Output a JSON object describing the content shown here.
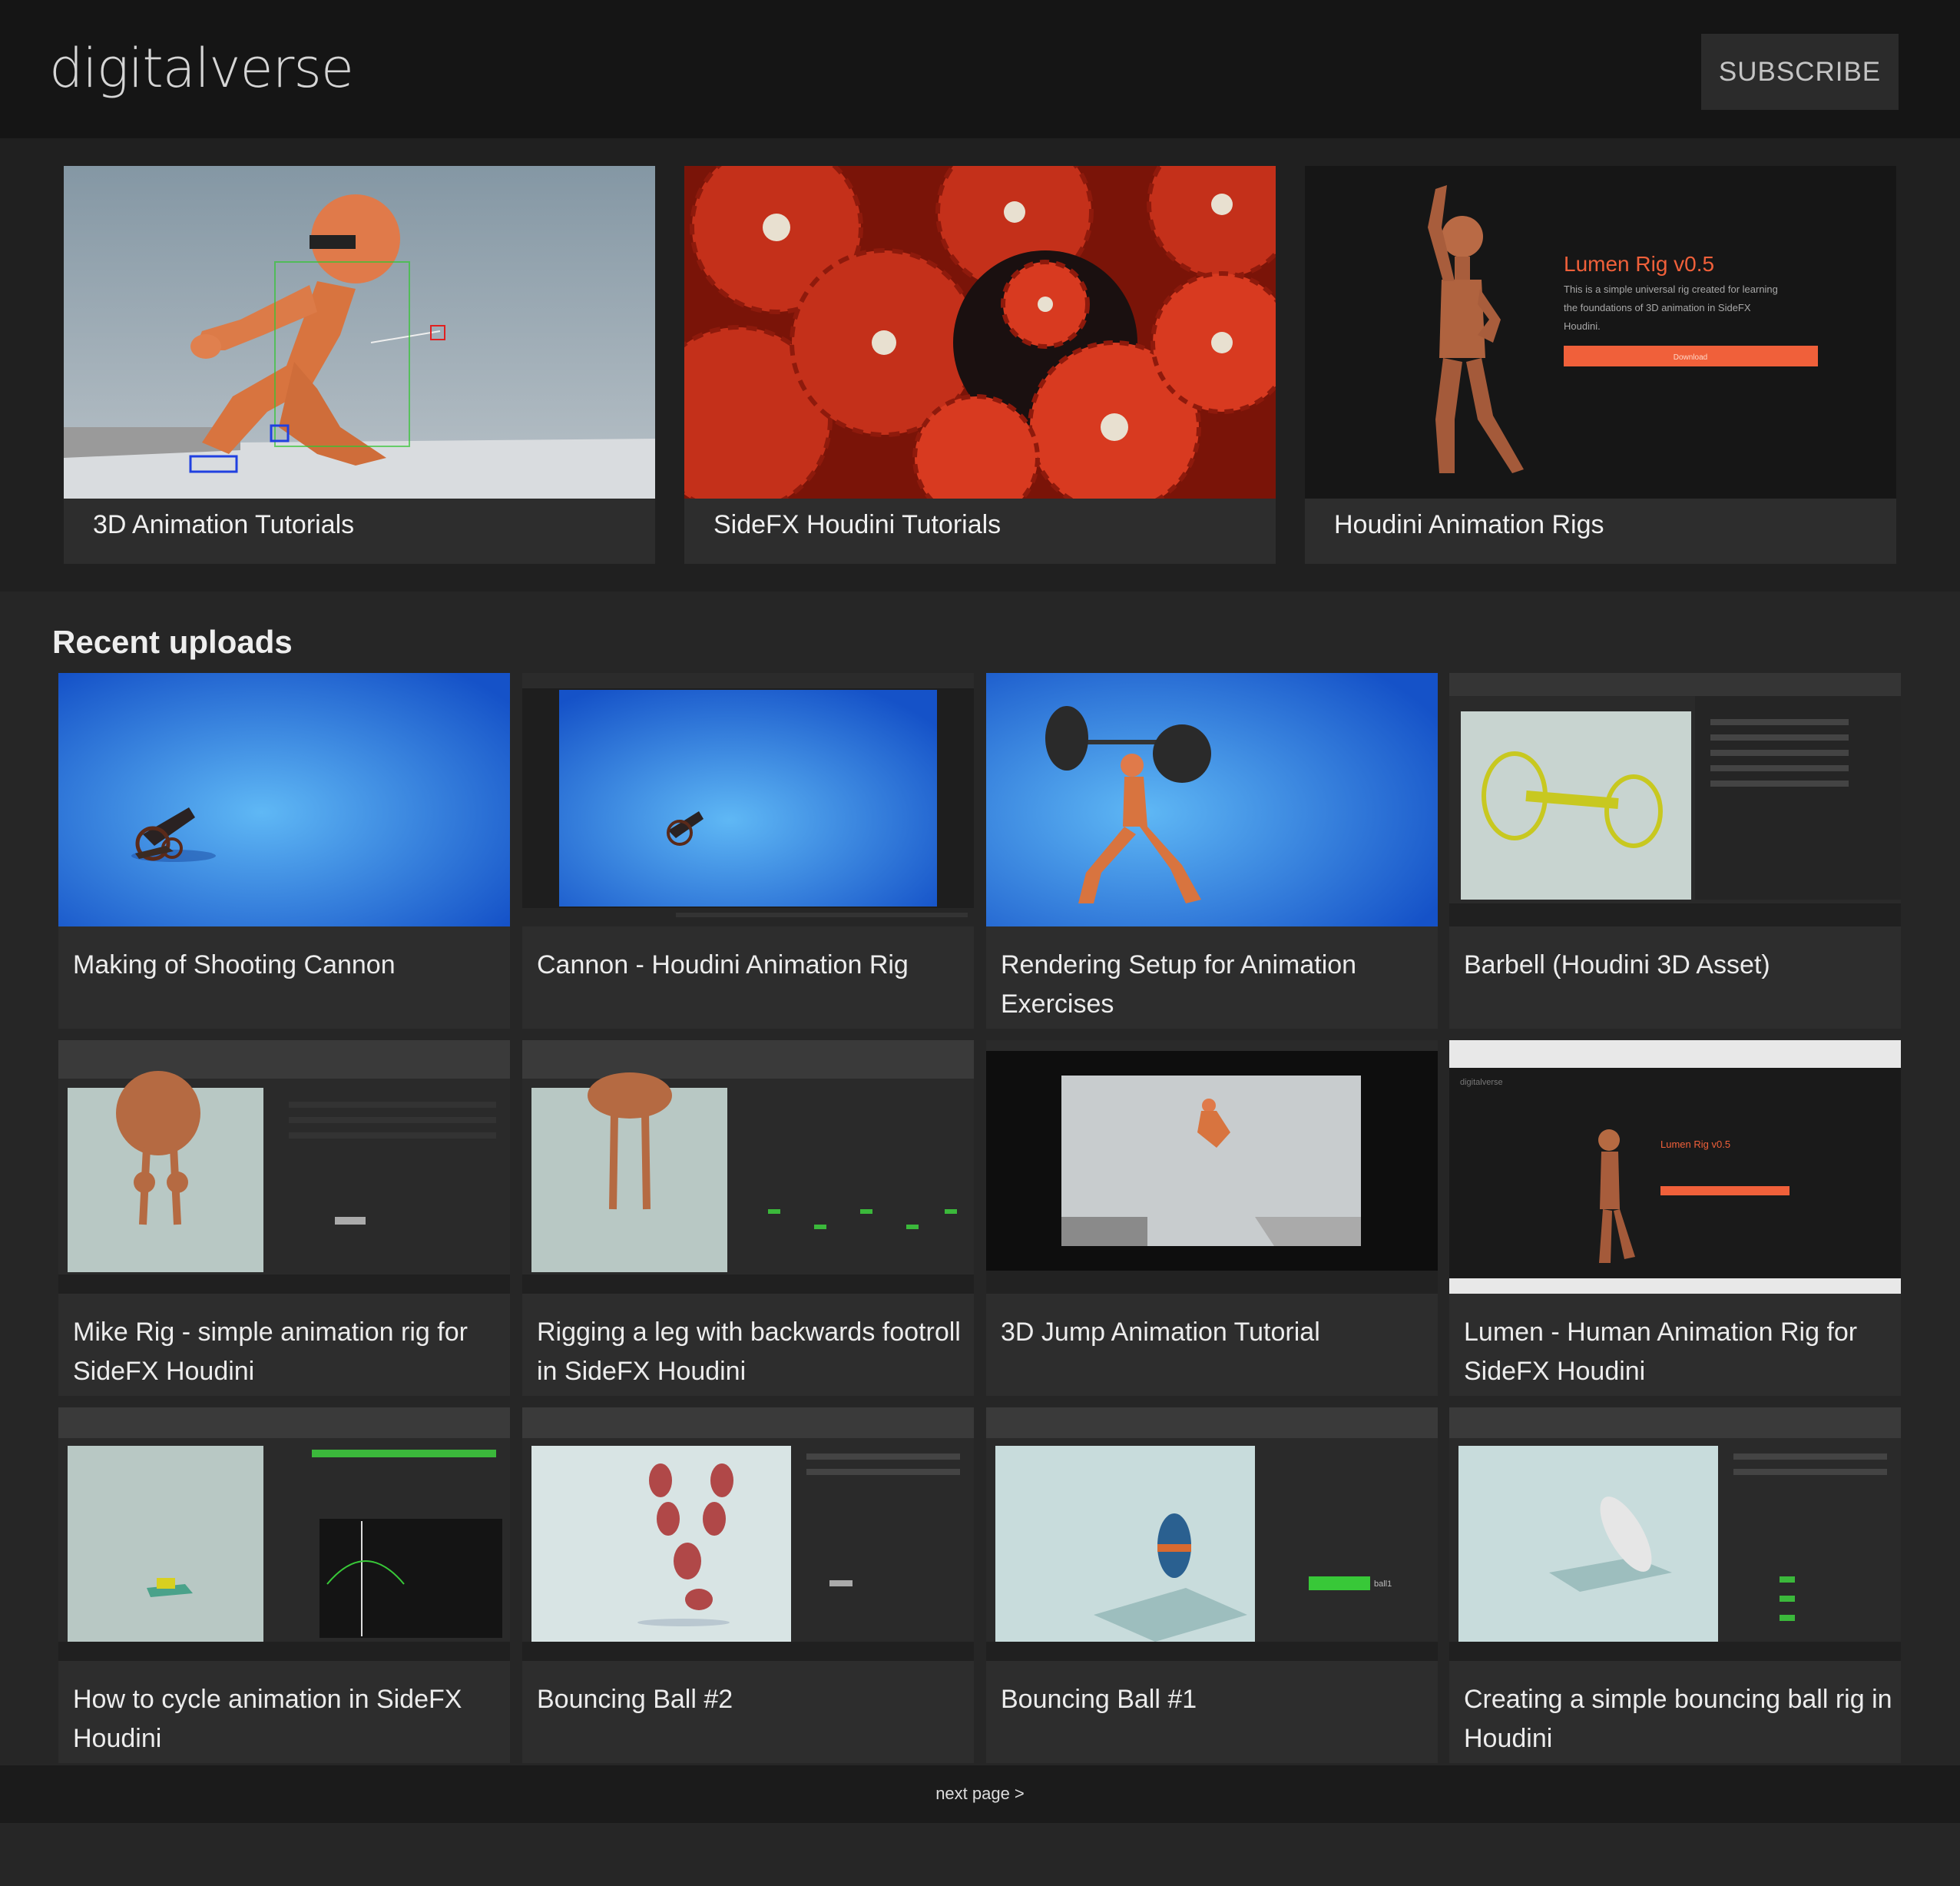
{
  "header": {
    "logo": "digitalverse",
    "subscribe": "SUBSCRIBE"
  },
  "featured": [
    {
      "title": "3D Animation Tutorials"
    },
    {
      "title": "SideFX Houdini Tutorials"
    },
    {
      "title": "Houdini Animation Rigs",
      "promo": {
        "heading": "Lumen Rig v0.5",
        "line1": "This is a simple universal rig created for learning",
        "line2": "the foundations of 3D animation in SideFX",
        "line3": "Houdini.",
        "button": "Download"
      }
    }
  ],
  "recent": {
    "title": "Recent uploads",
    "items": [
      {
        "title": "Making of Shooting Cannon"
      },
      {
        "title": "Cannon - Houdini Animation Rig"
      },
      {
        "title": "Rendering Setup for Animation Exercises"
      },
      {
        "title": "Barbell (Houdini 3D Asset)"
      },
      {
        "title": "Mike Rig - simple animation rig for SideFX Houdini"
      },
      {
        "title": "Rigging a leg with backwards footroll in SideFX Houdini"
      },
      {
        "title": "3D Jump Animation Tutorial"
      },
      {
        "title": "Lumen - Human Animation Rig for SideFX Houdini",
        "thumb_text": {
          "brand": "digitalverse",
          "heading": "Lumen Rig v0.5"
        }
      },
      {
        "title": "How to cycle animation in SideFX Houdini"
      },
      {
        "title": "Bouncing Ball #2"
      },
      {
        "title": "Bouncing Ball #1",
        "thumb_text": {
          "node": "ball1"
        }
      },
      {
        "title": "Creating a simple bouncing ball rig in Houdini"
      }
    ]
  },
  "pager": {
    "next": "next page >"
  },
  "colors": {
    "background": "#262626",
    "header": "#151515",
    "card": "#2d2d2d",
    "accent": "#f0603a"
  }
}
